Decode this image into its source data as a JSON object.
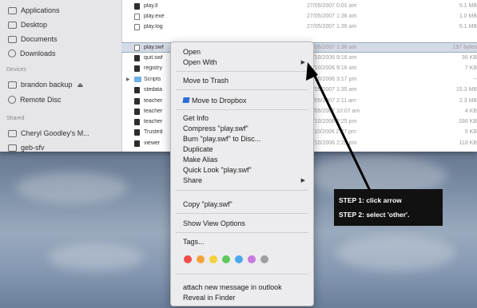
{
  "sidebar": {
    "favorites": [
      {
        "label": "Applications"
      },
      {
        "label": "Desktop"
      },
      {
        "label": "Documents"
      },
      {
        "label": "Downloads"
      }
    ],
    "devices_header": "Devices",
    "devices": [
      {
        "label": "brandon backup"
      },
      {
        "label": "Remote Disc"
      }
    ],
    "shared_header": "Shared",
    "shared": [
      {
        "label": "Cheryl Goodley's M..."
      },
      {
        "label": "geb-sfv"
      }
    ]
  },
  "files": [
    {
      "name": "play.ll",
      "date": "27/05/2007 0:01 am",
      "size": "5.1 MB"
    },
    {
      "name": "play.exe",
      "date": "27/05/2007 1:36 am",
      "size": "1.0 MB"
    },
    {
      "name": "play.log",
      "date": "27/05/2007 1:36 am",
      "size": "5.1 MB"
    },
    {
      "name": "play.swf",
      "date": "27/05/2007 1:36 am",
      "size": "197 bytes"
    },
    {
      "name": "quit.swf",
      "date": "15/10/2006 9:16 am",
      "size": "36 KB"
    },
    {
      "name": "registry",
      "date": "15/10/2006 9:16 am",
      "size": "7 KB"
    },
    {
      "name": "Scripts",
      "date": "15/10/2006 3:17 pm",
      "size": "--"
    },
    {
      "name": "stedata",
      "date": "27/05/2007 1:35 am",
      "size": "15.3 MB"
    },
    {
      "name": "teacher",
      "date": "27/05/2007 2:11 am",
      "size": "2.3 MB"
    },
    {
      "name": "teacher",
      "date": "17/05/2007 10:07 am",
      "size": "4 KB"
    },
    {
      "name": "teacher",
      "date": "15/10/2006 2:25 pm",
      "size": "336 KB"
    },
    {
      "name": "Trusted",
      "date": "11/10/2006 2:27 pm",
      "size": "5 KB"
    },
    {
      "name": "viewer",
      "date": "15/10/2006 2:25 pm",
      "size": "118 KB"
    }
  ],
  "menu": {
    "items": [
      "Open",
      "Open With",
      "Move to Trash",
      "Move to Dropbox",
      "Get Info",
      "Compress \"play.swf\"",
      "Burn \"play.swf\" to Disc...",
      "Duplicate",
      "Make Alias",
      "Quick Look \"play.swf\"",
      "Share",
      "Copy \"play.swf\"",
      "Show View Options",
      "Tags...",
      "attach new message in outlook",
      "Reveal in Finder"
    ],
    "tag_colors": [
      "#f04a4a",
      "#f6a13a",
      "#f3d23a",
      "#5fc85a",
      "#4aa8f0",
      "#c77ae0",
      "#9e9ea3"
    ]
  },
  "annotation": {
    "step1": "STEP 1: click arrow",
    "step2": "STEP 2: select 'other'."
  }
}
